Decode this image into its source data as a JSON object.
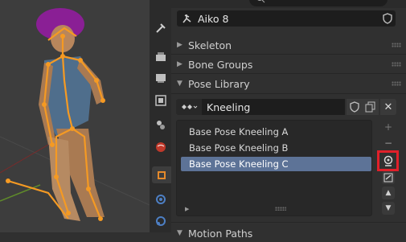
{
  "object": {
    "name": "Aiko 8"
  },
  "panels": {
    "skeleton": "Skeleton",
    "bone_groups": "Bone Groups",
    "pose_library": "Pose Library",
    "motion_paths": "Motion Paths"
  },
  "pose_library": {
    "library_name": "Kneeling",
    "poses": [
      "Base Pose Kneeling A",
      "Base Pose Kneeling B",
      "Base Pose Kneeling C"
    ],
    "selected_index": 2
  },
  "colors": {
    "selection": "#5d7397",
    "highlight_box": "#e0202a",
    "armature": "#f59a23"
  },
  "icons": {
    "tabs": [
      "tool-icon",
      "render-icon",
      "output-icon",
      "view-layer-icon",
      "scene-icon",
      "world-icon",
      "object-icon",
      "modifiers-icon",
      "physics-icon"
    ],
    "side_buttons": [
      "add-icon",
      "remove-icon",
      "apply-pose-icon",
      "sanitize-icon",
      "move-up-icon",
      "move-down-icon"
    ]
  }
}
